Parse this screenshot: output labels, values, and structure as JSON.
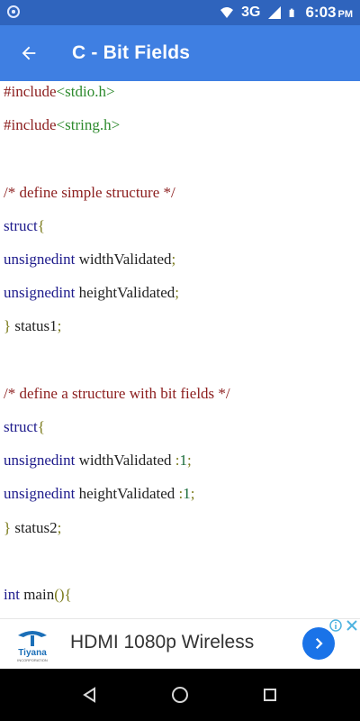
{
  "status_bar": {
    "network": "3G",
    "time": "6:03",
    "ampm": "PM",
    "icons": [
      "settings-dot-icon",
      "wifi-icon",
      "signal-icon",
      "battery-icon"
    ]
  },
  "app_bar": {
    "back_icon": "arrow-back-icon",
    "title": "C - Bit Fields"
  },
  "code": {
    "lines": [
      {
        "segments": [
          {
            "t": "#include",
            "c": "pp"
          },
          {
            "t": "<stdio.h>",
            "c": "inc"
          }
        ]
      },
      {
        "segments": [
          {
            "t": "#include",
            "c": "pp"
          },
          {
            "t": "<string.h>",
            "c": "inc"
          }
        ]
      },
      {
        "segments": []
      },
      {
        "segments": [
          {
            "t": "/* define simple structure */",
            "c": "cm"
          }
        ]
      },
      {
        "segments": [
          {
            "t": "struct",
            "c": "kw"
          },
          {
            "t": "{",
            "c": "br"
          }
        ]
      },
      {
        "segments": [
          {
            "t": "unsignedint",
            "c": "kw"
          },
          {
            "t": " widthValidated",
            "c": "tx"
          },
          {
            "t": ";",
            "c": "br"
          }
        ]
      },
      {
        "segments": [
          {
            "t": "unsignedint",
            "c": "kw"
          },
          {
            "t": " heightValidated",
            "c": "tx"
          },
          {
            "t": ";",
            "c": "br"
          }
        ]
      },
      {
        "segments": [
          {
            "t": "}",
            "c": "br"
          },
          {
            "t": " status1",
            "c": "tx"
          },
          {
            "t": ";",
            "c": "br"
          }
        ]
      },
      {
        "segments": []
      },
      {
        "segments": [
          {
            "t": "/* define a structure with bit fields */",
            "c": "cm"
          }
        ]
      },
      {
        "segments": [
          {
            "t": "struct",
            "c": "kw"
          },
          {
            "t": "{",
            "c": "br"
          }
        ]
      },
      {
        "segments": [
          {
            "t": "unsignedint",
            "c": "kw"
          },
          {
            "t": " widthValidated ",
            "c": "tx"
          },
          {
            "t": ":",
            "c": "br"
          },
          {
            "t": "1",
            "c": "num"
          },
          {
            "t": ";",
            "c": "br"
          }
        ]
      },
      {
        "segments": [
          {
            "t": "unsignedint",
            "c": "kw"
          },
          {
            "t": " heightValidated ",
            "c": "tx"
          },
          {
            "t": ":",
            "c": "br"
          },
          {
            "t": "1",
            "c": "num"
          },
          {
            "t": ";",
            "c": "br"
          }
        ]
      },
      {
        "segments": [
          {
            "t": "}",
            "c": "br"
          },
          {
            "t": " status2",
            "c": "tx"
          },
          {
            "t": ";",
            "c": "br"
          }
        ]
      },
      {
        "segments": []
      },
      {
        "segments": [
          {
            "t": "int",
            "c": "kw"
          },
          {
            "t": " main",
            "c": "tx"
          },
          {
            "t": "(){",
            "c": "br"
          }
        ]
      }
    ]
  },
  "ad": {
    "brand": "Tiyana",
    "brand_sub": "INCORPORATION",
    "text": "HDMI 1080p Wireless",
    "go_icon": "chevron-right-icon",
    "info_icon": "ad-info-icon",
    "close_icon": "close-icon"
  },
  "nav_bar": {
    "icons": [
      "nav-back-icon",
      "nav-home-icon",
      "nav-recents-icon"
    ]
  },
  "colors": {
    "status_bar": "#2f64bd",
    "app_bar": "#3f7fe2",
    "keyword": "#1d1a8b",
    "preprocessor": "#8b1d1d",
    "include_path": "#2d8a2d",
    "comment": "#8b1d1d",
    "bracket": "#7a7a1a",
    "ad_button": "#1a73e8"
  }
}
